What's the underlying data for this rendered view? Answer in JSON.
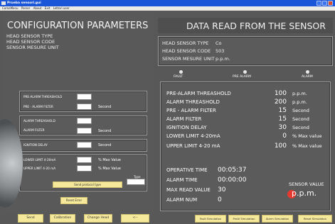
{
  "window": {
    "title": "Prueba sensori.gui",
    "menu": [
      "ComeMenu",
      "Parser",
      "About",
      "Exit",
      "Lettori user"
    ]
  },
  "config": {
    "title": "CONFIGURATION PARAMETERS",
    "head_sensor_type_label": "HEAD SENSOR TYPE",
    "head_sensor_code_label": "HEAD SENSOR CODE",
    "sensor_unit_label": "SENSOR MESURE UNIT",
    "fields": {
      "pre_alarm_threshold": "PRE-ALARM THREASHOLD",
      "pre_alarm_filter": "PRE - ALARM FILTER",
      "pre_alarm_filter_unit": "Second",
      "alarm_threshold": "ALARM THREASHOLD",
      "alarm_filter": "ALARM FILTER",
      "alarm_filter_unit": "Second",
      "ignition_delay": "IGNITION DELAY",
      "ignition_delay_unit": "Second",
      "lower_limit": "LOWER LIMIT 4-20mA",
      "lower_limit_unit": "% Max Value",
      "upper_limit": "UPPER LIMIT 4-20 mA",
      "upper_limit_unit": "% Max Value",
      "type_label": "Type",
      "send_protocol_button": "Send protocol type",
      "reset_error_button": "Reset Error"
    },
    "bottom_buttons": [
      "Send",
      "Calibration",
      "Change Head",
      "<--"
    ]
  },
  "data": {
    "title": "DATA READ FROM THE SENSOR",
    "head_type_label": "HEAD SENSOR TYPE",
    "head_type_value": "Co",
    "head_code_label": "HEAD SENSOR CODE",
    "head_code_value": "503",
    "unit_label": "SENSOR MESURE UNIT",
    "unit_value": "p.p.m.",
    "leds": [
      "FAULT",
      "PRE ALARM",
      "ALARM"
    ],
    "rows": [
      {
        "label": "PRE-ALARM THREASHOLD",
        "value": "100",
        "unit": "p.p.m."
      },
      {
        "label": "ALARM THREASHOLD",
        "value": "200",
        "unit": "p.p.m."
      },
      {
        "label": "PRE - ALARM FILTER",
        "value": "15",
        "unit": "Second"
      },
      {
        "label": "ALARM FILTER",
        "value": "15",
        "unit": "Second"
      },
      {
        "label": "IGNITION DELAY",
        "value": "30",
        "unit": "Second"
      },
      {
        "label": "LOWER LIMIT 4-20mA",
        "value": "0",
        "unit": "% Max value"
      },
      {
        "label": "UPPER LIMIT 4-20 mA",
        "value": "100",
        "unit": "% Max value"
      }
    ],
    "operative_time_label": "OPERATIVE TIME",
    "operative_time_value": "00:05:37",
    "alarm_time_label": "ALARM TIME",
    "alarm_time_value": "00:00:00",
    "max_read_label": "MAX READ VALUE",
    "max_read_value": "30",
    "alarm_num_label": "ALARM NUM",
    "alarm_num_value": "0",
    "sensor_value_label": "SENSOR VALUE",
    "sensor_value_unit": "p.p.m."
  },
  "simulation_buttons": [
    "Fault Simulation",
    "PreAl Simulation",
    "Alarm Simulation",
    "Reset Simulation"
  ],
  "colors": {
    "titlebar": "#1c56d8",
    "panel": "#595959",
    "button": "#f5e89a",
    "indicator": "#e53a2f"
  }
}
